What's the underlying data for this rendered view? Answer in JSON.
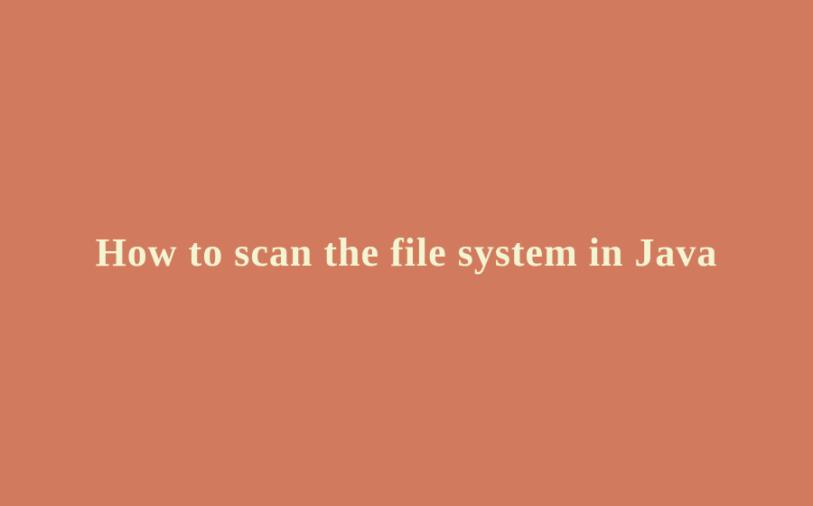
{
  "title": "How to scan the file system in Java"
}
